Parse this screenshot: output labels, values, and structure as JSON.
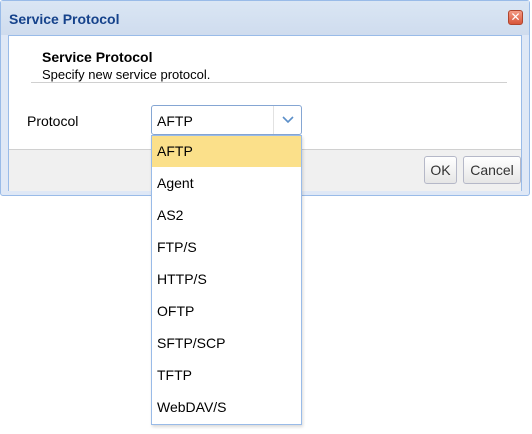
{
  "dialog": {
    "title": "Service Protocol",
    "close_icon": "close-icon",
    "heading": "Service Protocol",
    "subheading": "Specify new service protocol."
  },
  "form": {
    "protocol_label": "Protocol",
    "protocol_value": "AFTP",
    "dropdown_icon": "chevron-down-icon"
  },
  "dropdown": {
    "options": [
      "AFTP",
      "Agent",
      "AS2",
      "FTP/S",
      "HTTP/S",
      "OFTP",
      "SFTP/SCP",
      "TFTP",
      "WebDAV/S"
    ],
    "highlighted": "AFTP"
  },
  "footer": {
    "ok_label": "OK",
    "cancel_label": "Cancel"
  },
  "colors": {
    "title_text": "#15428b",
    "highlight": "#fbe08a",
    "window_border": "#99bbe8",
    "close_button": "#d8553a"
  }
}
